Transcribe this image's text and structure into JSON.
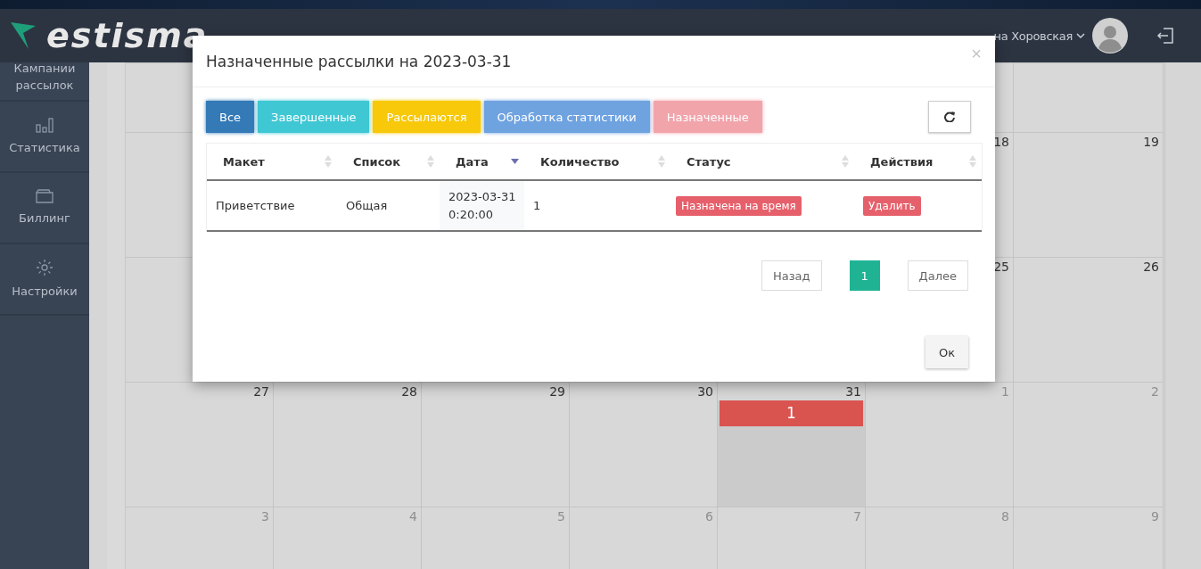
{
  "brand": "estisma",
  "header": {
    "user_name": "на Хоровская"
  },
  "sidebar": {
    "items": [
      {
        "label": "Кампании рассылок"
      },
      {
        "label": "Статистика"
      },
      {
        "label": "Биллинг"
      },
      {
        "label": "Настройки"
      }
    ]
  },
  "calendar": {
    "weeks": [
      {
        "days": [
          {
            "day": "18",
            "muted": false,
            "highlighted": false
          },
          {
            "day": "19",
            "muted": false,
            "highlighted": false
          }
        ]
      },
      {
        "days": [
          {
            "day": "25",
            "muted": false,
            "highlighted": false
          },
          {
            "day": "26",
            "muted": false,
            "highlighted": false
          }
        ]
      },
      {
        "days": [
          {
            "day": "27",
            "muted": false,
            "highlighted": false
          },
          {
            "day": "28",
            "muted": false,
            "highlighted": false
          },
          {
            "day": "29",
            "muted": false,
            "highlighted": false
          },
          {
            "day": "30",
            "muted": false,
            "highlighted": false
          },
          {
            "day": "31",
            "muted": false,
            "highlighted": true,
            "events": [
              "1"
            ]
          },
          {
            "day": "1",
            "muted": true,
            "highlighted": false
          },
          {
            "day": "2",
            "muted": true,
            "highlighted": false
          }
        ]
      },
      {
        "days": [
          {
            "day": "3",
            "muted": true,
            "highlighted": false
          },
          {
            "day": "4",
            "muted": true,
            "highlighted": false
          },
          {
            "day": "5",
            "muted": true,
            "highlighted": false
          },
          {
            "day": "6",
            "muted": true,
            "highlighted": false
          },
          {
            "day": "7",
            "muted": true,
            "highlighted": false
          },
          {
            "day": "8",
            "muted": true,
            "highlighted": false
          },
          {
            "day": "9",
            "muted": true,
            "highlighted": false
          }
        ]
      }
    ]
  },
  "modal": {
    "title": "Назначенные рассылки на 2023-03-31",
    "close": "×",
    "filters": [
      {
        "label": "Все",
        "color": "#337ab7"
      },
      {
        "label": "Завершенные",
        "color": "#3fc7d4"
      },
      {
        "label": "Рассылаются",
        "color": "#f7c90a"
      },
      {
        "label": "Обработка статистики",
        "color": "#6fa3e0"
      },
      {
        "label": "Назначенные",
        "color": "#f2a4ab"
      }
    ],
    "table": {
      "columns": [
        {
          "label": "Макет",
          "sorted": false
        },
        {
          "label": "Список",
          "sorted": false
        },
        {
          "label": "Дата",
          "sorted": true
        },
        {
          "label": "Количество",
          "sorted": false
        },
        {
          "label": "Статус",
          "sorted": false
        },
        {
          "label": "Действия",
          "sorted": false
        }
      ],
      "rows": [
        {
          "template": "Приветствие",
          "list": "Общая",
          "date": "2023-03-31 0:20:00",
          "count": "1",
          "status": "Назначена на время",
          "action": "Удалить"
        }
      ]
    },
    "pagination": {
      "prev": "Назад",
      "pages": [
        {
          "label": "1",
          "selected": true
        }
      ],
      "next": "Далее"
    },
    "ok": "Ок"
  }
}
